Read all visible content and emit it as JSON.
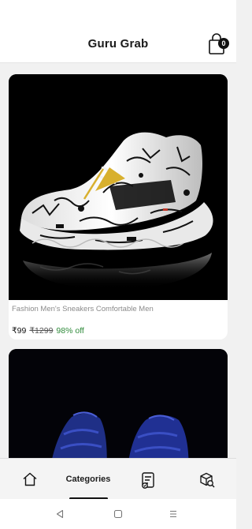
{
  "header": {
    "title": "Guru Grab",
    "cart_icon": "shopping-bag-icon",
    "cart_count": "0"
  },
  "products": [
    {
      "name": "Fashion Men's Sneakers Comfortable Men",
      "price": "₹99",
      "mrp": "₹1299",
      "discount": "98% off",
      "image": "white-black-graffiti-sneaker"
    },
    {
      "image": "blue-sneakers"
    }
  ],
  "bottom_nav": {
    "items": [
      {
        "icon": "home-icon"
      },
      {
        "label": "Categories",
        "active": true
      },
      {
        "icon": "orders-list-icon"
      },
      {
        "icon": "package-search-icon"
      }
    ]
  },
  "system_nav": {
    "back_icon": "back-triangle-icon",
    "home_icon": "home-square-icon",
    "recents_icon": "menu-lines-icon"
  },
  "colors": {
    "discount": "#2f8a3a",
    "nav_background": "#f4f4f4",
    "page_background": "#f1f1f1"
  }
}
